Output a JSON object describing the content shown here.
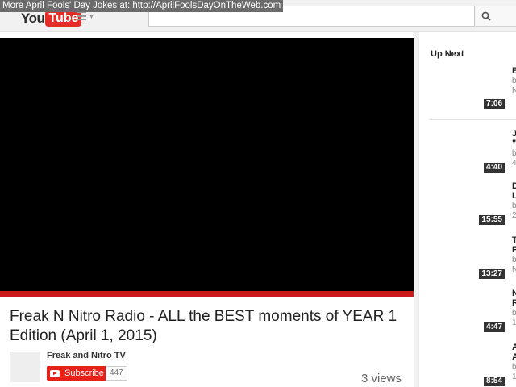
{
  "banner": {
    "text": "More April Fools' Day Jokes at: http://AprilFoolsDayOnTheWeb.com"
  },
  "header": {
    "logo_you": "You",
    "logo_tube": "Tube",
    "guide_icon": "menu-icon",
    "search_icon": "search-icon"
  },
  "video": {
    "title": "Freak N Nitro Radio - ALL the BEST moments of YEAR 1 Edition (April 1, 2015)",
    "channel": "Freak and Nitro TV",
    "subscribe_label": "Subscribe",
    "subscriber_count": "447",
    "views": "3 views"
  },
  "sidebar": {
    "heading": "Up Next",
    "items": [
      {
        "duration": "7:06",
        "title": "E",
        "by": "b",
        "meta": "N"
      },
      {
        "duration": "4:40",
        "title": "J\n\"",
        "by": "b",
        "meta": "4"
      },
      {
        "duration": "15:55",
        "title": "D\nL",
        "by": "b",
        "meta": "2"
      },
      {
        "duration": "13:27",
        "title": "T\nP",
        "by": "b",
        "meta": "N"
      },
      {
        "duration": "4:47",
        "title": "N\nR",
        "by": "b",
        "meta": "1"
      },
      {
        "duration": "8:54",
        "title": "A\nA",
        "by": "b",
        "meta": "1"
      }
    ]
  },
  "colors": {
    "accent": "#cc181e",
    "subscribe": "#e62117",
    "player": "#000000"
  }
}
